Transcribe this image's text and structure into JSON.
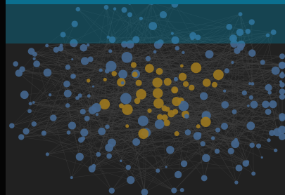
{
  "window": {
    "title": ""
  },
  "graph": {
    "node_color_primary": "#d9a62b",
    "node_color_secondary": "#5f8fc7",
    "edge_color": "#5a5a5a",
    "canvas_bg": "#2f2f2f",
    "overlay_color": "#0b6f8f"
  },
  "legend": {
    "items": []
  },
  "search": {
    "placeholder": ""
  }
}
